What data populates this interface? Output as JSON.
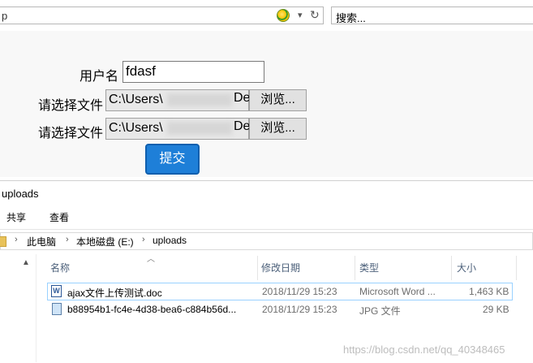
{
  "browser": {
    "address_text": "p",
    "search_placeholder": "搜索..."
  },
  "form": {
    "username_label": "用户名",
    "username_value": "fdasf",
    "file_label_1": "请选择文件",
    "file_path_1_start": "C:\\Users\\",
    "file_path_1_end": "De",
    "file_label_2": "请选择文件",
    "file_path_2_start": "C:\\Users\\",
    "file_path_2_end": "De",
    "browse_label": "浏览...",
    "submit_label": "提交"
  },
  "explorer": {
    "title": "uploads",
    "ribbon_tabs": [
      "共享",
      "查看"
    ],
    "breadcrumb": [
      "此电脑",
      "本地磁盘 (E:)",
      "uploads"
    ],
    "columns": [
      "名称",
      "修改日期",
      "类型",
      "大小"
    ],
    "files": [
      {
        "name": "ajax文件上传测试.doc",
        "date": "2018/11/29 15:23",
        "type": "Microsoft Word ...",
        "size": "1,463 KB",
        "icon": "word-doc-icon"
      },
      {
        "name": "b88954b1-fc4e-4d38-bea6-c884b56d...",
        "date": "2018/11/29 15:23",
        "type": "JPG 文件",
        "size": "29 KB",
        "icon": "jpg-file-icon"
      }
    ]
  },
  "watermark": "https://blog.csdn.net/qq_40348465",
  "colors": {
    "submit_bg": "#1e7fd8",
    "selection_border": "#99d1ff"
  }
}
